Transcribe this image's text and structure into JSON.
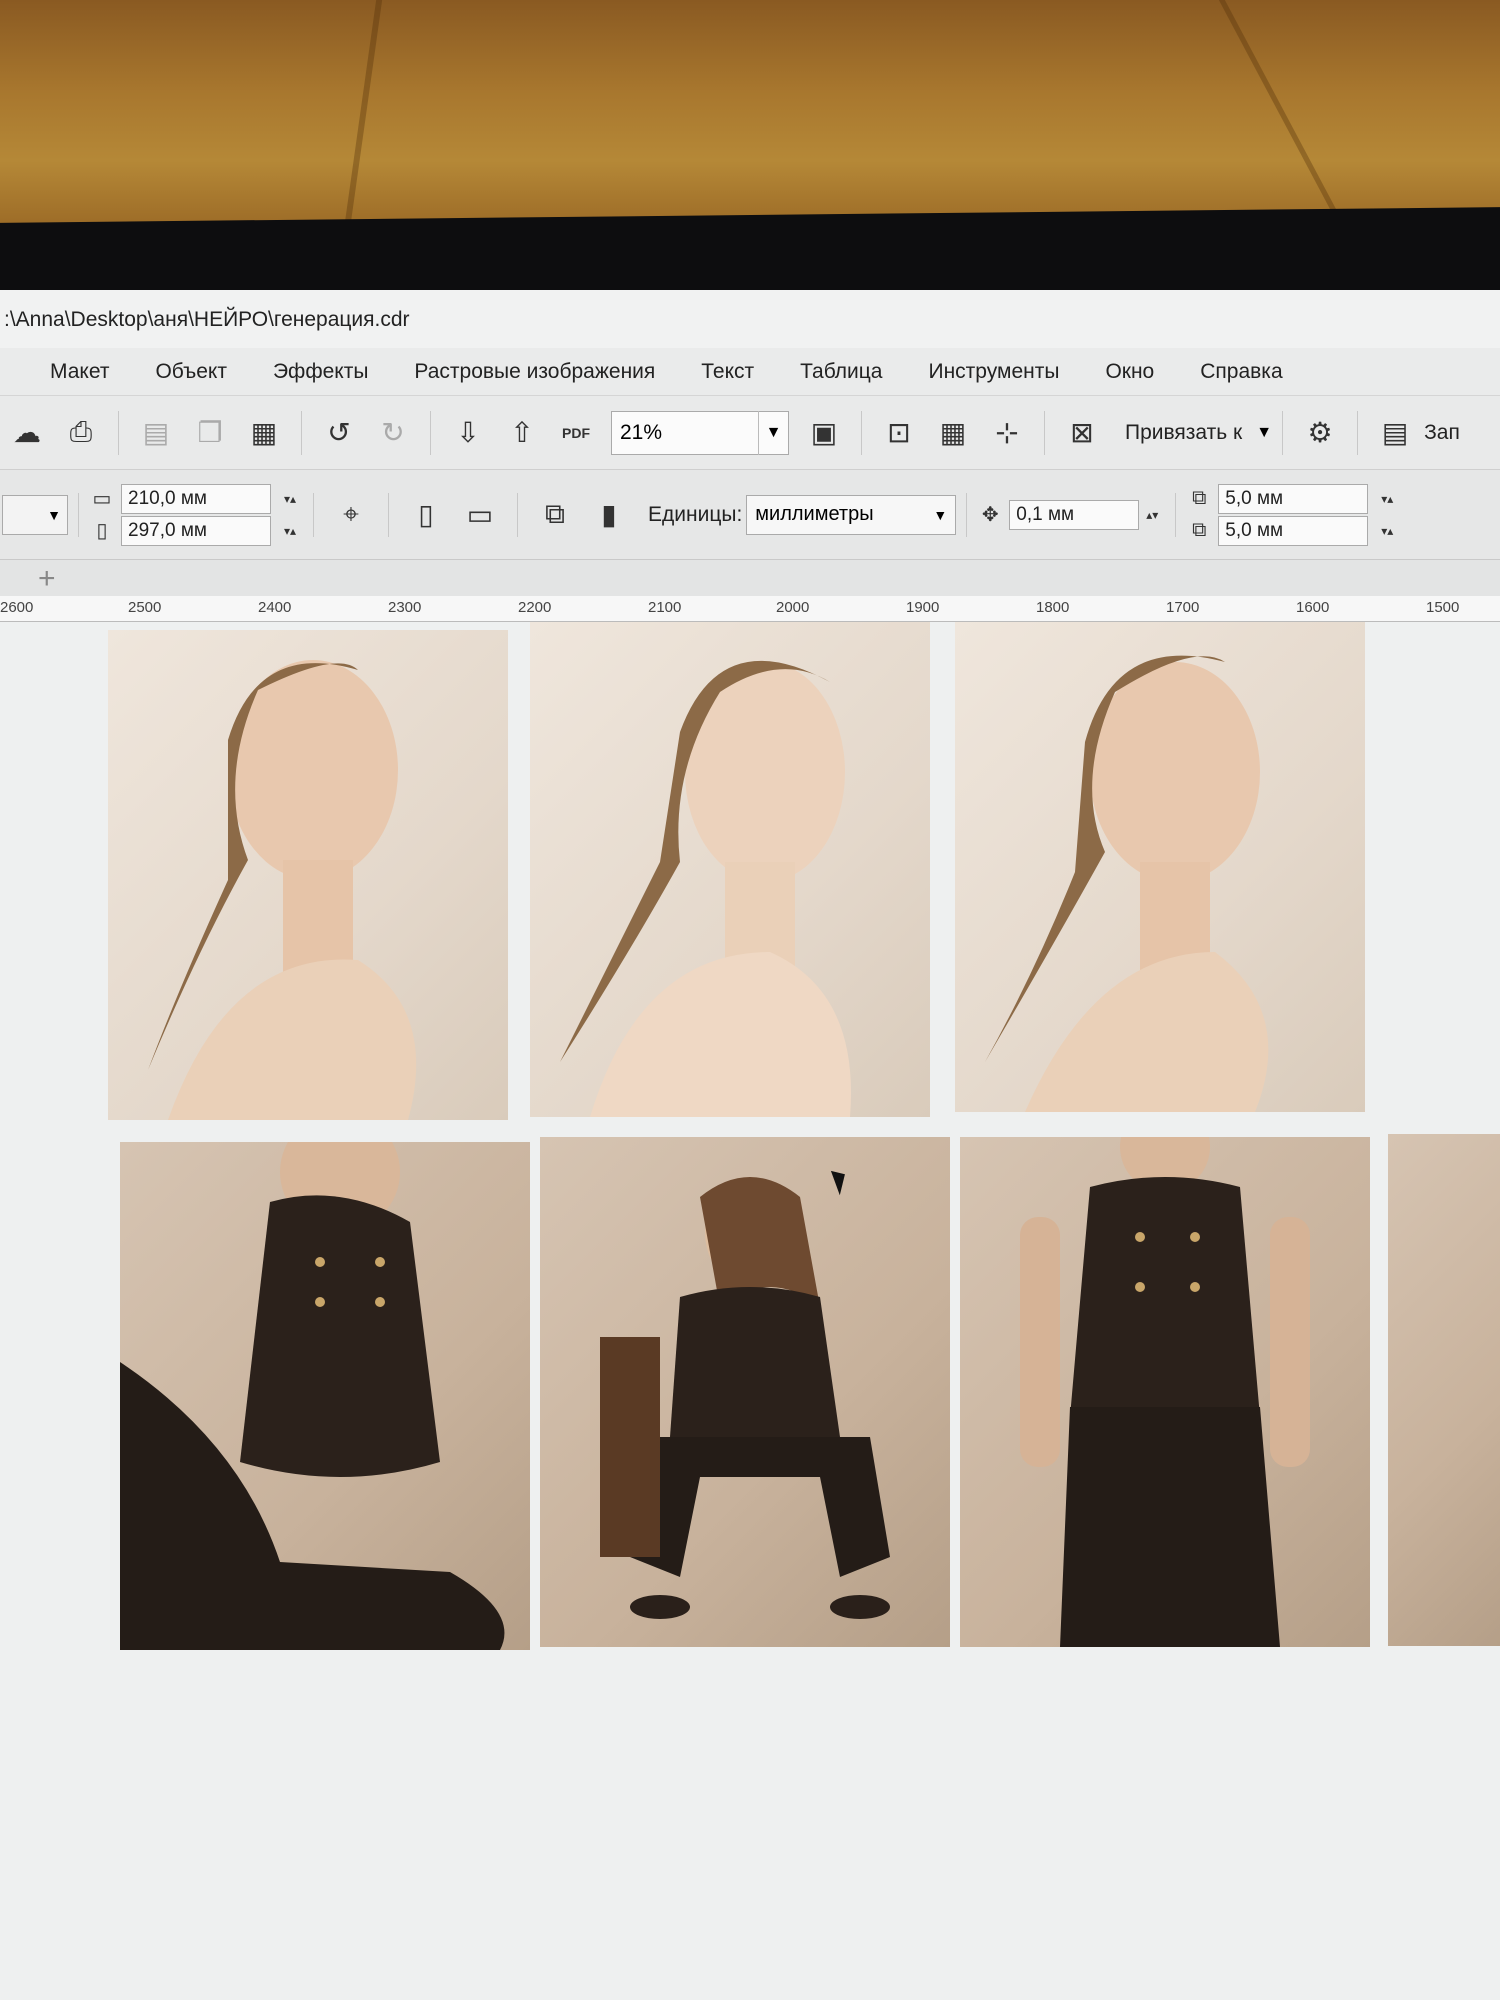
{
  "window": {
    "title": ":\\Anna\\Desktop\\аня\\НЕЙРО\\генерация.cdr"
  },
  "menu": [
    "Макет",
    "Объект",
    "Эффекты",
    "Растровые изображения",
    "Текст",
    "Таблица",
    "Инструменты",
    "Окно",
    "Справка"
  ],
  "toolbar": {
    "zoom_value": "21%",
    "pdf_label": "PDF",
    "snap_label": "Привязать к",
    "launch_label": "Зап"
  },
  "properties": {
    "width": "210,0 мм",
    "height": "297,0 мм",
    "units_label": "Единицы:",
    "units_value": "миллиметры",
    "nudge": "0,1 мм",
    "dup_x": "5,0 мм",
    "dup_y": "5,0 мм"
  },
  "ruler": [
    "2600",
    "2500",
    "2400",
    "2300",
    "2200",
    "2100",
    "2000",
    "1900",
    "1800",
    "1700",
    "1600",
    "1500"
  ],
  "icons": [
    "upload-icon",
    "print-icon",
    "cut-icon",
    "copy-icon",
    "paste-icon",
    "undo-icon",
    "redo-icon",
    "import-icon",
    "export-icon",
    "full-screen-icon",
    "rulers-icon",
    "grid-icon",
    "guidelines-icon",
    "snap-off-icon",
    "settings-icon",
    "app-launcher-icon"
  ],
  "colors": {
    "wall": "#a8772e",
    "ui_bg": "#e9eaea",
    "canvas": "#eef0f0"
  }
}
